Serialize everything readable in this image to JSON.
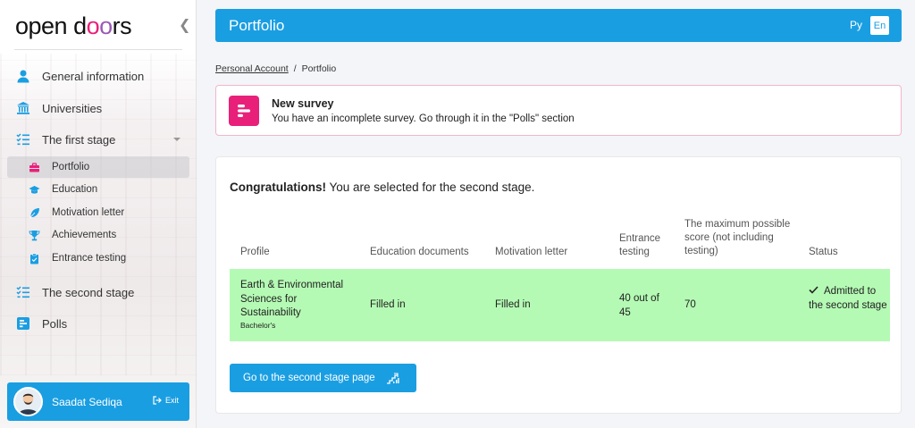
{
  "sidebar": {
    "logo": {
      "part1": "open d",
      "o1": "o",
      "o2": "o",
      "part2": "rs"
    },
    "collapse_symbol": "❮",
    "items": [
      {
        "label": "General information",
        "icon": "user-icon"
      },
      {
        "label": "Universities",
        "icon": "university-icon"
      },
      {
        "label": "The first stage",
        "icon": "checklist-icon"
      },
      {
        "label": "The second stage",
        "icon": "checklist-icon"
      },
      {
        "label": "Polls",
        "icon": "poll-icon"
      }
    ],
    "subitems": [
      {
        "label": "Portfolio",
        "icon": "briefcase-icon",
        "active": true
      },
      {
        "label": "Education",
        "icon": "graduation-cap-icon"
      },
      {
        "label": "Motivation letter",
        "icon": "feather-icon"
      },
      {
        "label": "Achievements",
        "icon": "trophy-icon"
      },
      {
        "label": "Entrance testing",
        "icon": "clipboard-icon"
      }
    ],
    "user": {
      "name": "Saadat Sediqa",
      "exit_label": "Exit"
    }
  },
  "header": {
    "title": "Portfolio",
    "lang_ru": "Ру",
    "lang_en": "En"
  },
  "breadcrumb": {
    "root": "Personal Account",
    "separator": "/",
    "current": "Portfolio"
  },
  "notice": {
    "title": "New survey",
    "text": "You have an incomplete survey. Go through it in the \"Polls\" section"
  },
  "main": {
    "congrats_bold": "Congratulations!",
    "congrats_rest": " You are selected for the second stage.",
    "table": {
      "headers": {
        "profile": "Profile",
        "education": "Education documents",
        "motivation": "Motivation letter",
        "entrance": "Entrance testing",
        "max_score": "The maximum possible score (not including testing)",
        "status": "Status"
      },
      "row": {
        "profile": "Earth & Environmental Sciences for Sustainability",
        "degree": "Bachelor's",
        "education": "Filled in",
        "motivation": "Filled in",
        "entrance": "40 out of 45",
        "max_score": "70",
        "status": "Admitted to the second stage"
      }
    },
    "button_label": "Go to the second stage page"
  },
  "colors": {
    "primary": "#1a9ee2",
    "accent": "#e8207a",
    "success_row": "#b4fab4"
  }
}
